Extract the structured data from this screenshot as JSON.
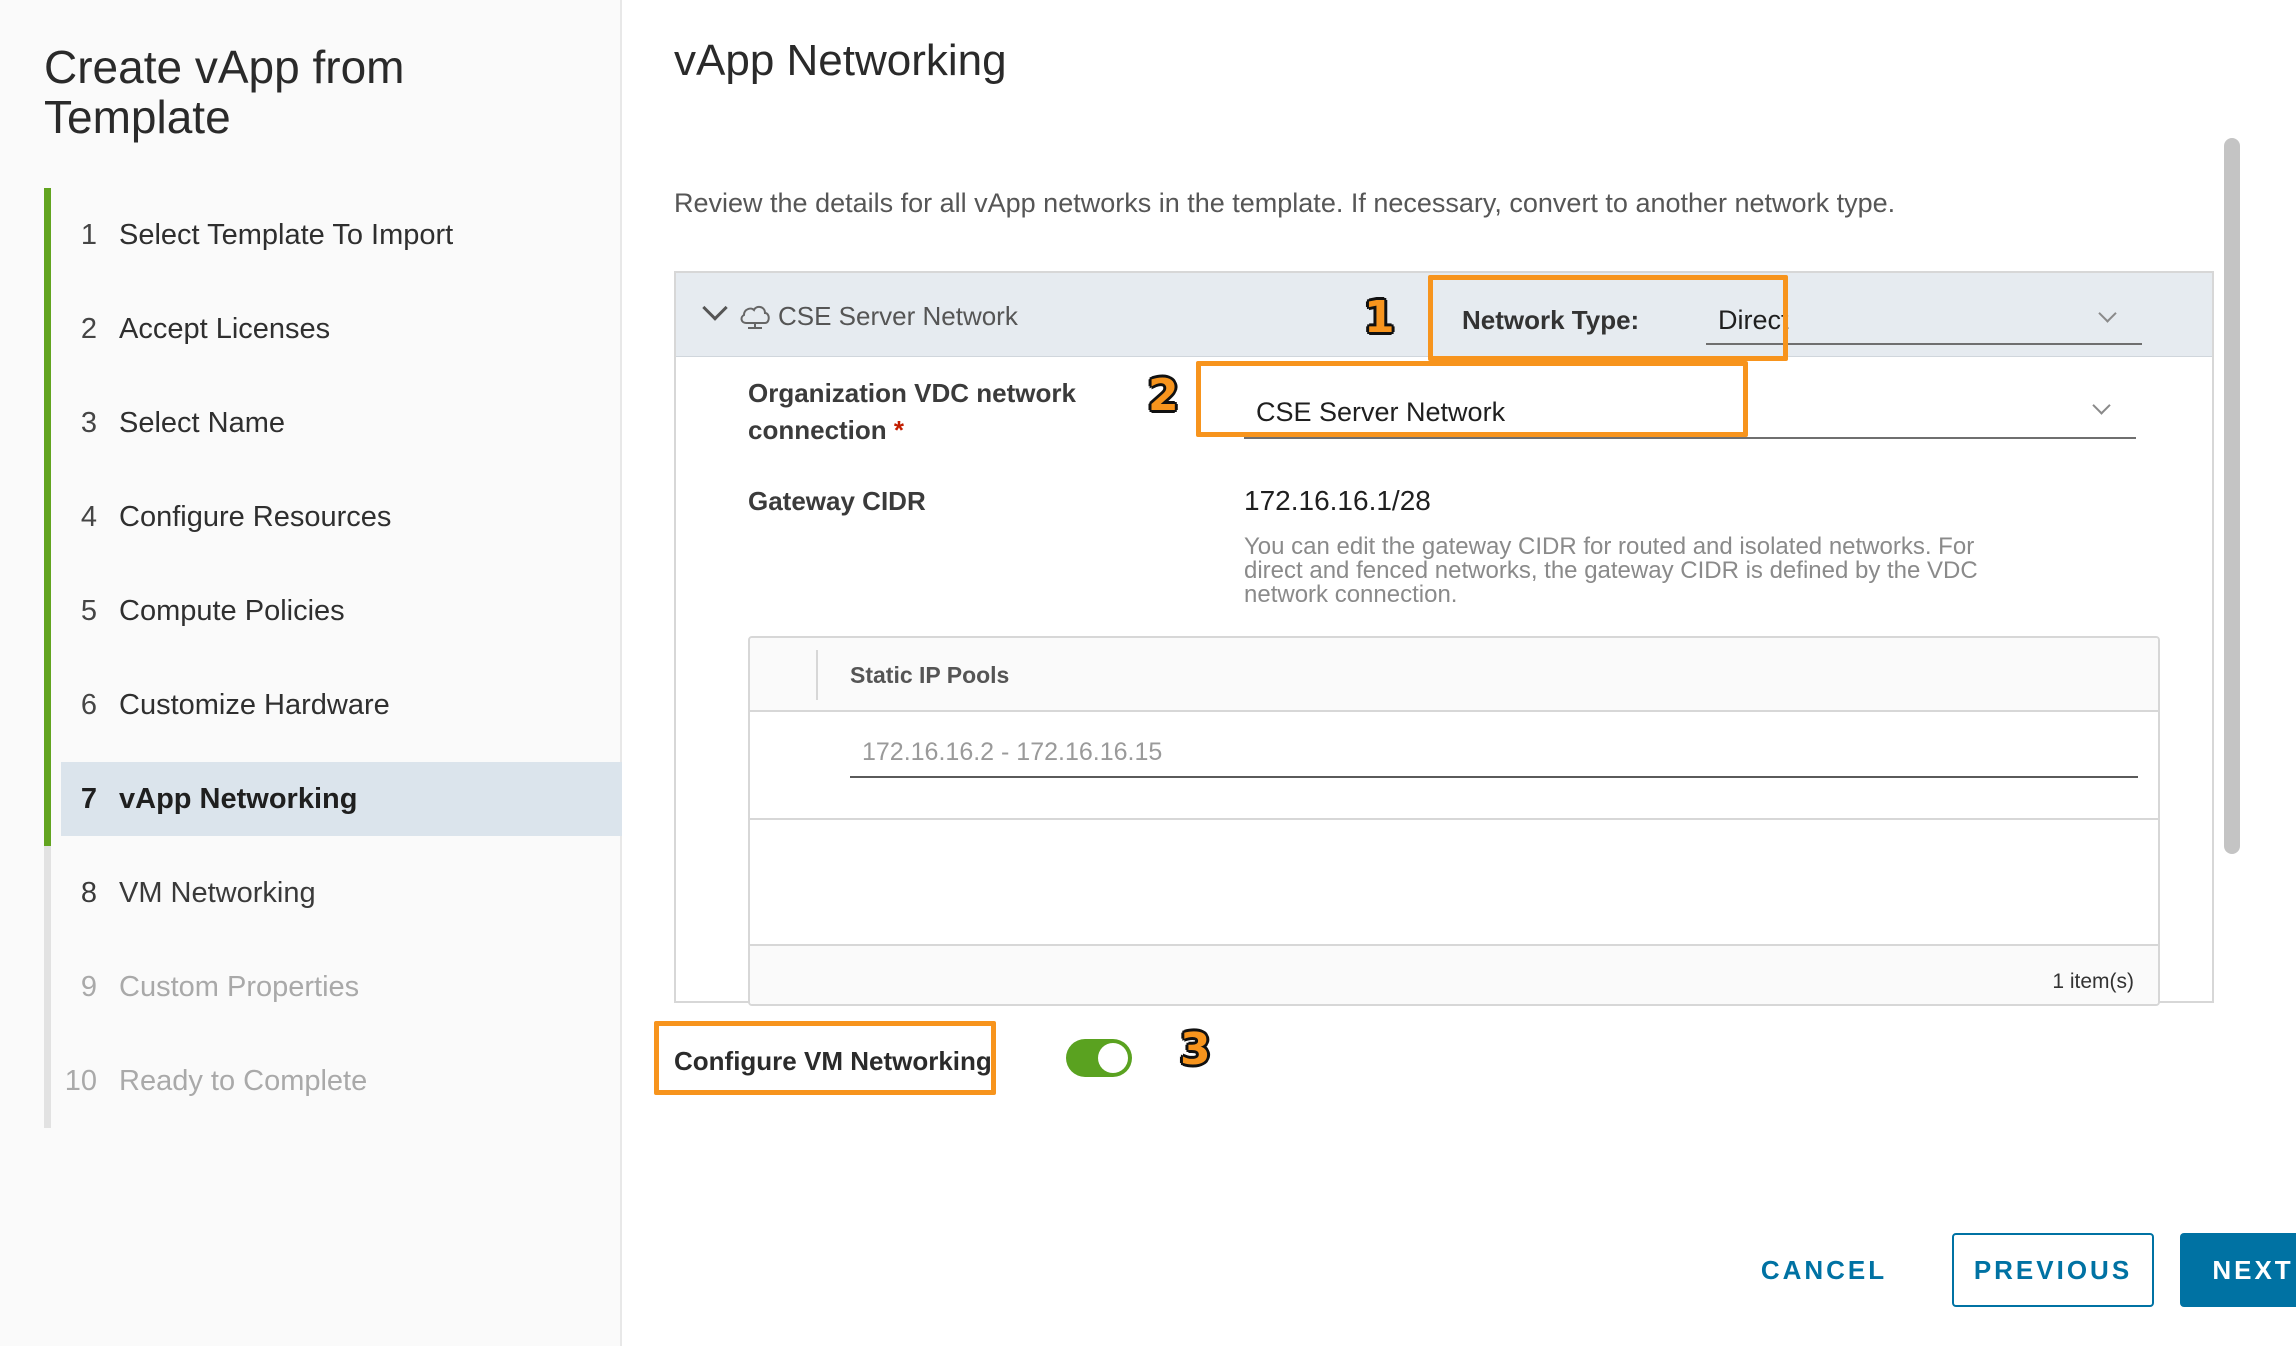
{
  "wizard": {
    "title": "Create vApp from Template",
    "steps": [
      {
        "number": "1",
        "label": "Select Template To Import",
        "state": "completed"
      },
      {
        "number": "2",
        "label": "Accept Licenses",
        "state": "completed"
      },
      {
        "number": "3",
        "label": "Select Name",
        "state": "completed"
      },
      {
        "number": "4",
        "label": "Configure Resources",
        "state": "completed"
      },
      {
        "number": "5",
        "label": "Compute Policies",
        "state": "completed"
      },
      {
        "number": "6",
        "label": "Customize Hardware",
        "state": "completed"
      },
      {
        "number": "7",
        "label": "vApp Networking",
        "state": "active"
      },
      {
        "number": "8",
        "label": "VM Networking",
        "state": "future"
      },
      {
        "number": "9",
        "label": "Custom Properties",
        "state": "disabled"
      },
      {
        "number": "10",
        "label": "Ready to Complete",
        "state": "disabled"
      }
    ]
  },
  "main": {
    "title": "vApp Networking",
    "description": "Review the details for all vApp networks in the template. If necessary, convert to another network type."
  },
  "network_card": {
    "name": "CSE Server Network",
    "cloud_icon": "cloud-icon",
    "network_type_label": "Network Type:",
    "network_type_value": "Direct",
    "org_vdc_label_line1": "Organization VDC network",
    "org_vdc_label_line2": "connection",
    "required_marker": "*",
    "org_vdc_value": "CSE Server Network",
    "gateway_label": "Gateway CIDR",
    "gateway_value": "172.16.16.1/28",
    "gateway_help_line1": "You can edit the gateway CIDR for routed and isolated networks. For",
    "gateway_help_line2": "direct and fenced networks, the gateway CIDR is defined by the VDC",
    "gateway_help_line3": "network connection.",
    "static_pools": {
      "column_title": "Static IP Pools",
      "rows": [
        "172.16.16.2 - 172.16.16.15"
      ],
      "footer": "1 item(s)"
    }
  },
  "configure_vm": {
    "label": "Configure VM Networking",
    "enabled": true
  },
  "annotations": {
    "badge_1": "1",
    "badge_2": "2",
    "badge_3": "3",
    "highlight_color": "#f7941d"
  },
  "buttons": {
    "cancel": "CANCEL",
    "previous": "PREVIOUS",
    "next": "NEXT"
  },
  "colors": {
    "accent": "#0072a3",
    "progress": "#62a420",
    "toggle_on": "#5aa220"
  }
}
